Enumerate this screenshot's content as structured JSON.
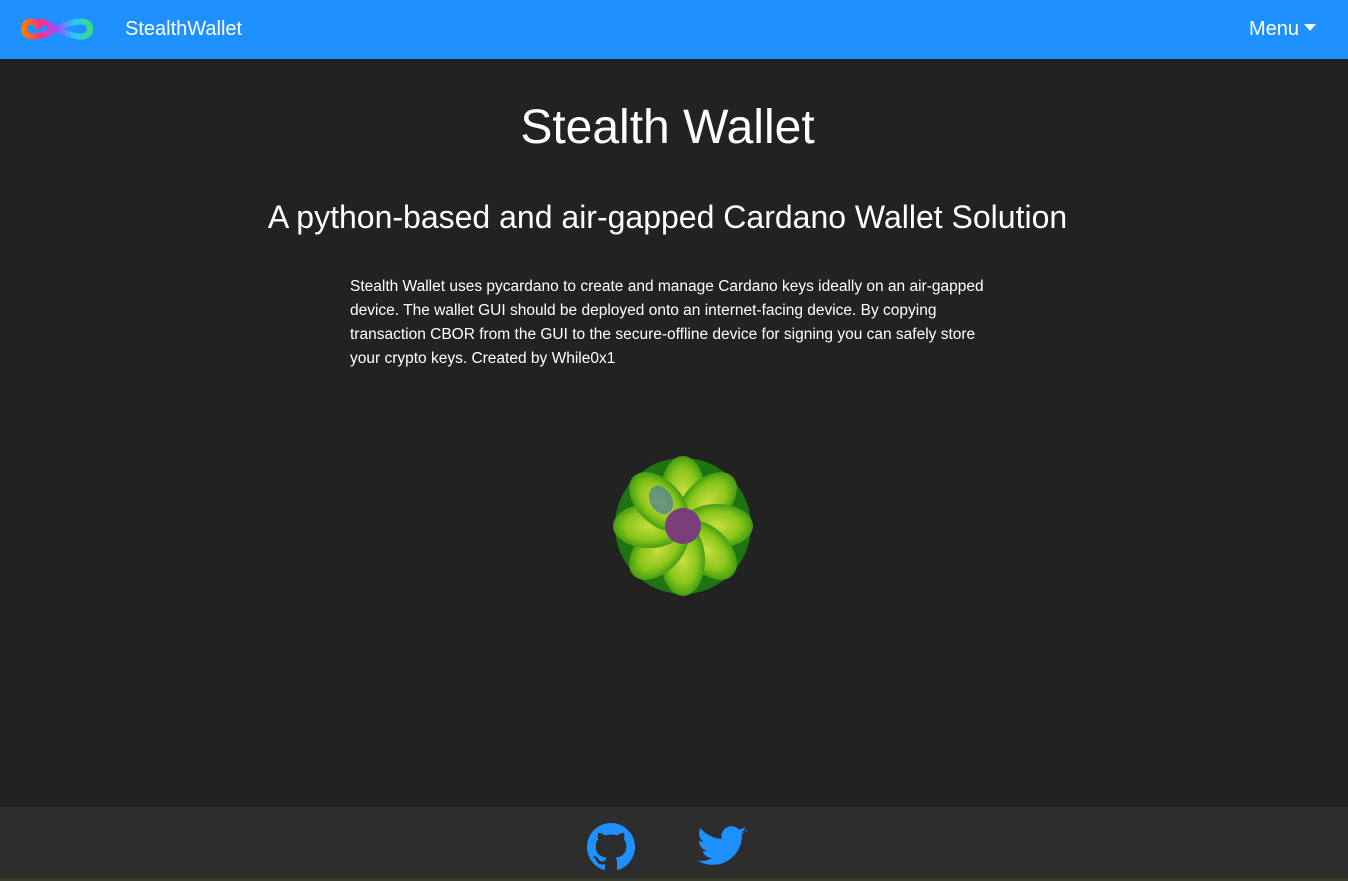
{
  "navbar": {
    "brand": "StealthWallet",
    "menu_label": "Menu",
    "logo_icon": "infinity-logo-icon",
    "background_color": "#1e90ff"
  },
  "main": {
    "title": "Stealth Wallet",
    "subtitle": "A python-based and air-gapped Cardano Wallet Solution",
    "description": "Stealth Wallet uses pycardano to create and manage Cardano keys ideally on an air-gapped device. The wallet GUI should be deployed onto an internet-facing device. By copying transaction CBOR from the GUI to the secure-offline device for signing you can safely store your crypto keys. Created by While0x1",
    "spinner_icon": "flower-spinner-icon"
  },
  "footer": {
    "links": [
      {
        "icon": "github-icon"
      },
      {
        "icon": "twitter-icon"
      }
    ],
    "icon_color": "#1e90ff"
  }
}
